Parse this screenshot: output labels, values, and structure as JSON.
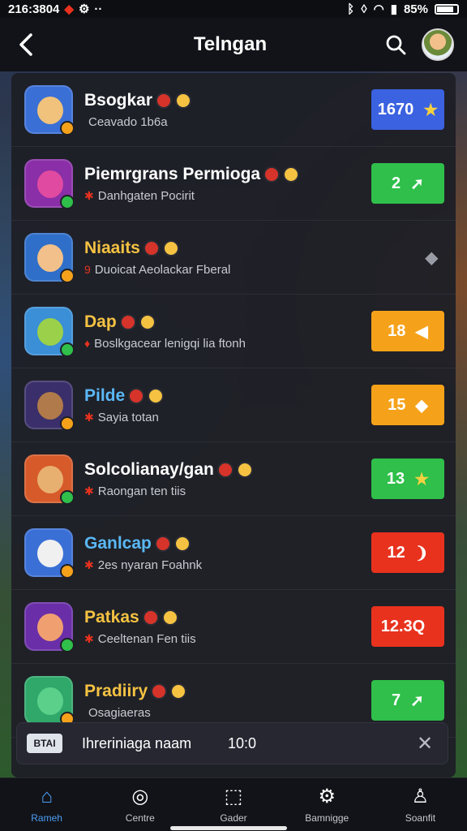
{
  "status_bar": {
    "time": "216:3804",
    "battery": "85%"
  },
  "header": {
    "title": "Telngan"
  },
  "rows": [
    {
      "title": "Bsogkar",
      "subtitle": "Ceavado 1b6a",
      "sub_mark": "",
      "title_color": "#ffffff",
      "action_label": "1670",
      "action_color": "#3b62e0",
      "action_icon": "★",
      "icon_bg": "#3a6fd6",
      "face_color": "#f0c27b"
    },
    {
      "title": "Piemrgrans Permioga",
      "subtitle": "Danhgaten Pocirit",
      "sub_mark": "✱",
      "title_color": "#ffffff",
      "action_label": "2",
      "action_color": "#2fbf4a",
      "action_icon": "➚",
      "icon_bg": "#8a2fa8",
      "face_color": "#e04aa0"
    },
    {
      "title": "Niaaits",
      "subtitle": "Duoicat Aeolackar Fberal",
      "sub_mark": "9",
      "title_color": "#f5c242",
      "action_label": "",
      "action_color": "transparent",
      "action_icon": "◆",
      "icon_bg": "#2f6fc9",
      "face_color": "#f2c08a"
    },
    {
      "title": "Dap",
      "subtitle": "Boslkgacear lenigqi lia ftonh",
      "sub_mark": "♦",
      "title_color": "#f5c242",
      "action_label": "18",
      "action_color": "#f5a21a",
      "action_icon": "◀",
      "icon_bg": "#3a8fd6",
      "face_color": "#9ad04a"
    },
    {
      "title": "Pilde",
      "subtitle": "Sayia totan",
      "sub_mark": "✱",
      "title_color": "#5ab8f5",
      "action_label": "15",
      "action_color": "#f5a21a",
      "action_icon": "◆",
      "icon_bg": "#3a2f6a",
      "face_color": "#b07a4a"
    },
    {
      "title": "Solcolianay/gan",
      "subtitle": "Raongan ten tiis",
      "sub_mark": "✱",
      "title_color": "#ffffff",
      "action_label": "13",
      "action_color": "#2fbf4a",
      "action_icon": "★",
      "icon_bg": "#d65a2a",
      "face_color": "#e8b070"
    },
    {
      "title": "Ganlcap",
      "subtitle": "2es nyaran Foahnk",
      "sub_mark": "✱",
      "title_color": "#5ab8f5",
      "action_label": "12",
      "action_color": "#e8321e",
      "action_icon": "❩",
      "icon_bg": "#3a6fd6",
      "face_color": "#f0f0f0"
    },
    {
      "title": "Patkas",
      "subtitle": "Ceeltenan Fen tiis",
      "sub_mark": "✱",
      "title_color": "#f5c242",
      "action_label": "12.3Q",
      "action_color": "#e8321e",
      "action_icon": "",
      "icon_bg": "#6a2fa8",
      "face_color": "#f0a070"
    },
    {
      "title": "Pradiiry",
      "subtitle": "Osagiaeras",
      "sub_mark": "",
      "title_color": "#f5c242",
      "action_label": "7",
      "action_color": "#2fbf4a",
      "action_icon": "➚",
      "icon_bg": "#2fa86a",
      "face_color": "#5ad08a"
    }
  ],
  "toast": {
    "icon_text": "BTAI",
    "text": "Ihreriniaga naam",
    "time": "10:0"
  },
  "tabs": [
    {
      "label": "Rameh",
      "icon": "⌂",
      "active": true
    },
    {
      "label": "Centre",
      "icon": "◎",
      "active": false
    },
    {
      "label": "Gader",
      "icon": "⬚",
      "active": false
    },
    {
      "label": "Bamnigge",
      "icon": "⚙",
      "active": false
    },
    {
      "label": "Soanfit",
      "icon": "♙",
      "active": false
    }
  ]
}
